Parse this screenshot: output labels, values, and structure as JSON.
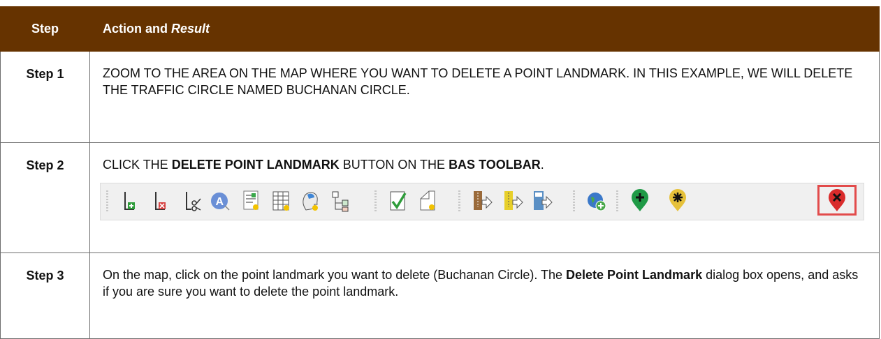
{
  "header": {
    "step": "Step",
    "action_prefix": "Action and ",
    "action_italic": "Result"
  },
  "rows": [
    {
      "step": "Step 1",
      "text": "ZOOM TO THE AREA ON THE MAP WHERE YOU WANT TO DELETE A POINT LANDMARK. IN THIS EXAMPLE, WE WILL DELETE THE TRAFFIC CIRCLE NAMED BUCHANAN CIRCLE."
    },
    {
      "step": "Step 2",
      "t1": "CLICK THE ",
      "b1": "DELETE POINT LANDMARK",
      "t2": " BUTTON ON THE ",
      "b2": "BAS TOOLBAR",
      "t3": "."
    },
    {
      "step": "Step 3",
      "t1": "On the map, click on the point landmark you want to delete (Buchanan Circle). The ",
      "b1": "Delete Point Landmark",
      "t2": " dialog box opens, and asks if you are sure you want to delete the point landmark."
    }
  ],
  "toolbar_icons": [
    "add-line-icon",
    "delete-line-icon",
    "split-line-icon",
    "area-label-icon",
    "new-document-icon",
    "table-icon",
    "head-profile-icon",
    "hierarchy-icon",
    "check-edit-icon",
    "edit-polygon-icon",
    "zip-export-icon",
    "zip-export-yellow-icon",
    "export-map-icon",
    "add-globe-icon",
    "add-point-landmark-icon",
    "edit-point-landmark-icon",
    "delete-point-landmark-icon"
  ],
  "highlight_color": "#e24b4b",
  "header_color": "#663300"
}
